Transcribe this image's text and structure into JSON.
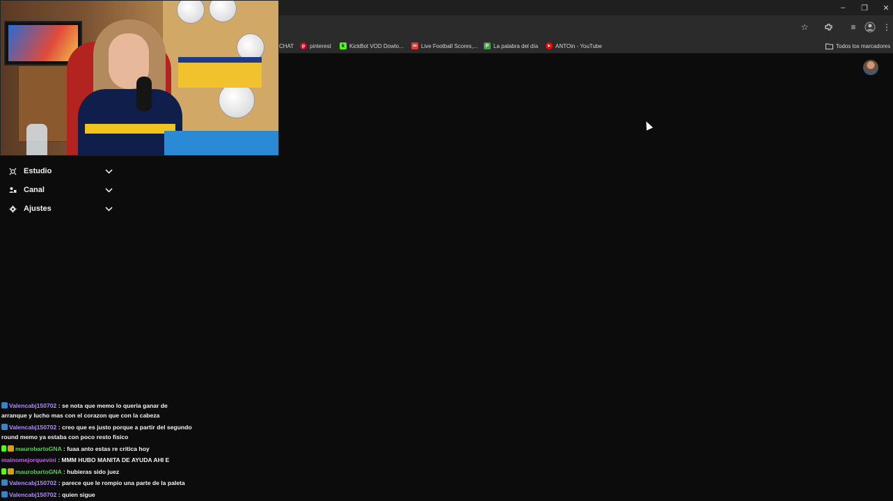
{
  "browser": {
    "window_controls": {
      "minimize": "–",
      "maximize": "❐",
      "close": "✕"
    },
    "toolbar_icons": [
      "star-icon",
      "extensions-icon",
      "media-icon",
      "profile-icon",
      "menu-icon"
    ],
    "bookmarks": [
      {
        "label": "CHAT",
        "icon": "",
        "color": ""
      },
      {
        "label": "pinterest",
        "icon": "p",
        "color": "#e60023"
      },
      {
        "label": "KickBot VOD Dowlo...",
        "icon": "k",
        "color": "#53fc18"
      },
      {
        "label": "Live Football Scores,...",
        "icon": "ss",
        "color": "#e53935"
      },
      {
        "label": "La palabra del día",
        "icon": "P",
        "color": "#43a047"
      },
      {
        "label": "ANTOin - YouTube",
        "icon": "▶",
        "color": "#ff0000"
      }
    ],
    "all_bookmarks_label": "Todos los marcadores"
  },
  "sidebar": {
    "items": [
      {
        "label": "Estudio",
        "icon": "studio-icon"
      },
      {
        "label": "Canal",
        "icon": "channel-icon"
      },
      {
        "label": "Ajustes",
        "icon": "settings-icon"
      }
    ]
  },
  "chat": {
    "messages": [
      {
        "user": "Valencabj150702",
        "user_color": "#b28cff",
        "badges": [
          "#3b82c4"
        ],
        "text": ": se nota que memo lo queria ganar de",
        "continuation": "arranque y lucho mas con el corazon que con la cabeza"
      },
      {
        "user": "Valencabj150702",
        "user_color": "#b28cff",
        "badges": [
          "#3b82c4"
        ],
        "text": ": creo que es justo porque a partir del segundo",
        "continuation": "round memo ya estaba con poco resto fisico"
      },
      {
        "user": "maurobartoGNA",
        "user_color": "#4ad64a",
        "badges": [
          "#53fc18",
          "#d4a017"
        ],
        "text": ": fuaa anto estas re critica hoy",
        "continuation": ""
      },
      {
        "user": "mainomejorquevini",
        "user_color": "#c85cf0",
        "badges": [],
        "text": ": MMM HUBO MANITA DE AYUDA AHI E",
        "continuation": ""
      },
      {
        "user": "maurobartoGNA",
        "user_color": "#4ad64a",
        "badges": [
          "#53fc18",
          "#d4a017"
        ],
        "text": ": hubieras sido juez",
        "continuation": ""
      },
      {
        "user": "Valencabj150702",
        "user_color": "#b28cff",
        "badges": [
          "#3b82c4"
        ],
        "text": ": parece que le rompio una parte de la paleta",
        "continuation": ""
      },
      {
        "user": "Valencabj150702",
        "user_color": "#b28cff",
        "badges": [
          "#3b82c4"
        ],
        "text": ": quien sigue",
        "continuation": ""
      }
    ]
  }
}
